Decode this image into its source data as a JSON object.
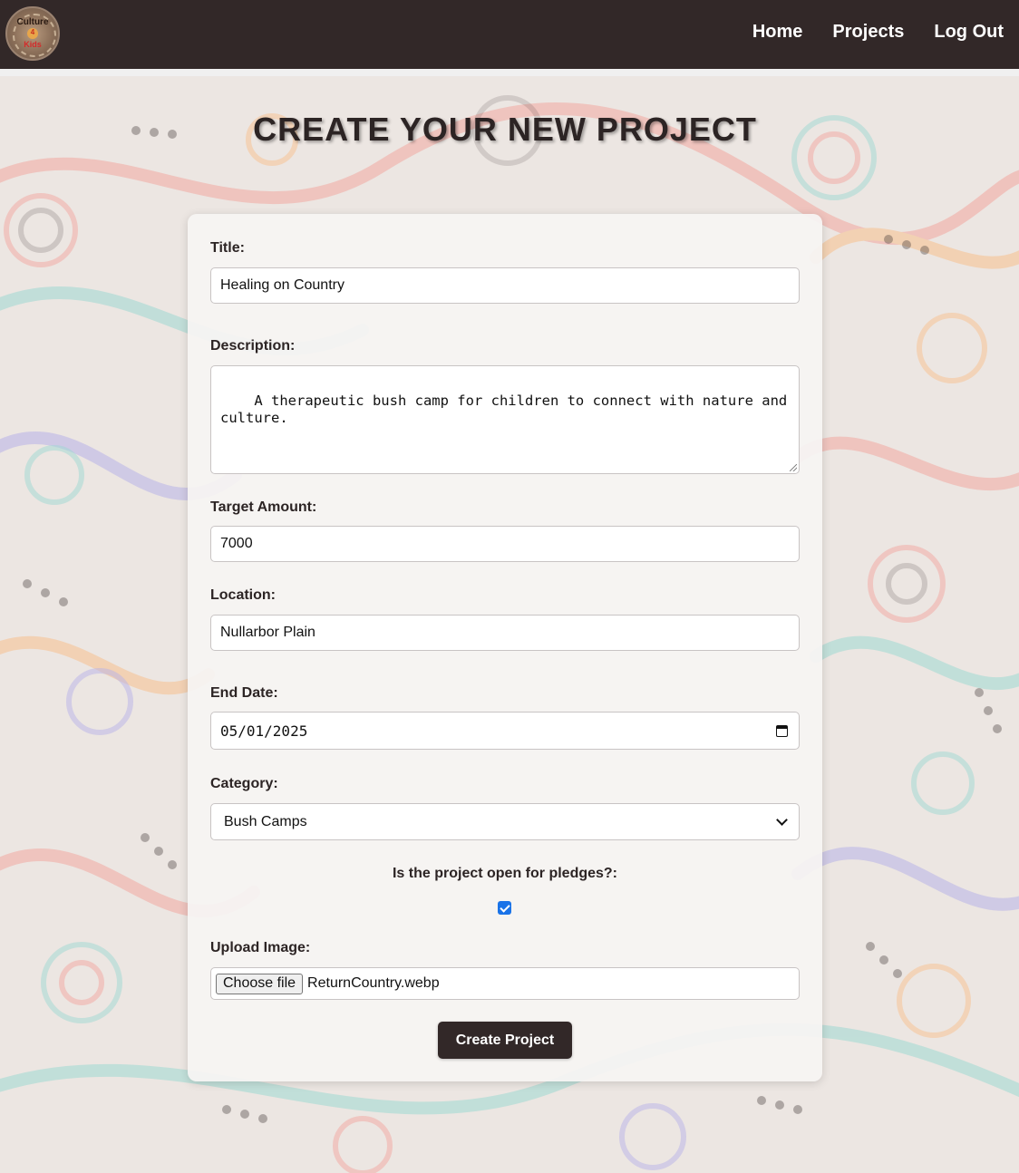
{
  "nav": {
    "logo": {
      "line1": "Culture",
      "line2": "4",
      "line3": "Kids"
    },
    "links": [
      "Home",
      "Projects",
      "Log Out"
    ]
  },
  "page": {
    "title": "CREATE YOUR NEW PROJECT"
  },
  "form": {
    "title_label": "Title:",
    "title_value": "Healing on Country",
    "description_label": "Description:",
    "description_value": "A therapeutic bush camp for children to connect with nature and\nculture.",
    "target_label": "Target Amount:",
    "target_value": "7000",
    "location_label": "Location:",
    "location_value": "Nullarbor Plain",
    "end_date_label": "End Date:",
    "end_date_value": "05/01/2025",
    "category_label": "Category:",
    "category_value": "Bush Camps",
    "pledges_label": "Is the project open for pledges?:",
    "pledges_checked": true,
    "upload_label": "Upload Image:",
    "upload_button": "Choose file",
    "upload_filename": "ReturnCountry.webp",
    "submit_label": "Create Project"
  },
  "colors": {
    "navbar": "#322828",
    "button": "#322828",
    "checkbox": "#1a73e8"
  }
}
